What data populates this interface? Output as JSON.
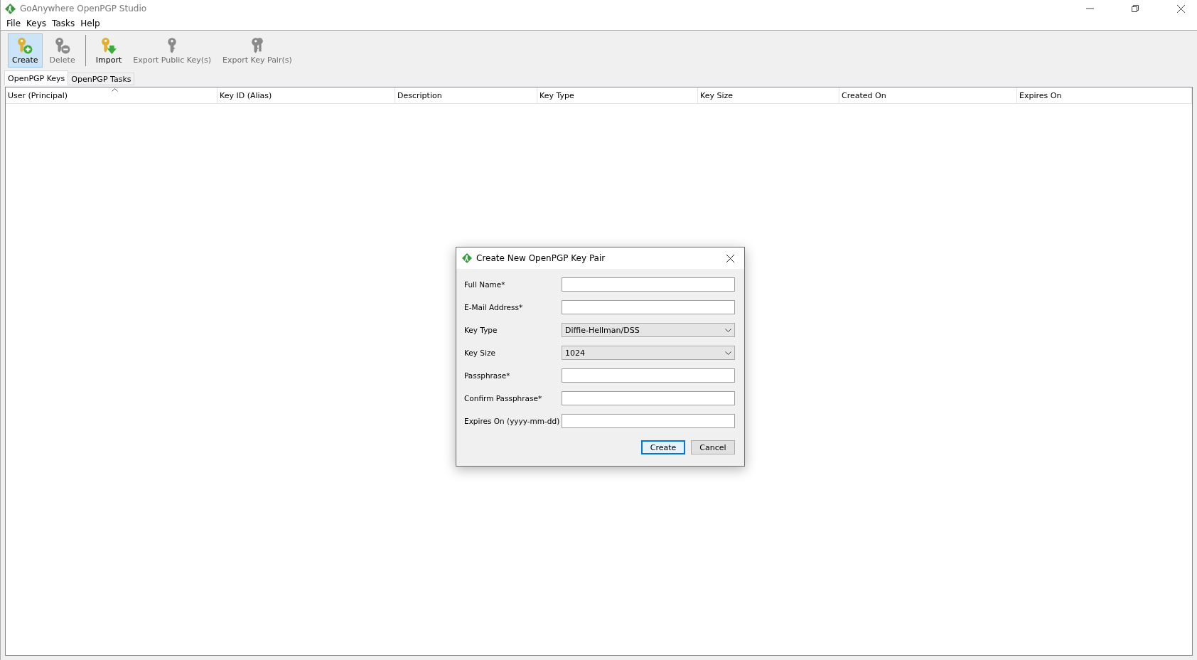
{
  "window": {
    "title": "GoAnywhere OpenPGP Studio"
  },
  "menu": [
    "File",
    "Keys",
    "Tasks",
    "Help"
  ],
  "toolbar": [
    {
      "label": "Create",
      "kind": "create",
      "selected": true,
      "disabled": false
    },
    {
      "label": "Delete",
      "kind": "delete",
      "selected": false,
      "disabled": true
    },
    {
      "label": "Import",
      "kind": "import",
      "selected": false,
      "disabled": false
    },
    {
      "label": "Export Public Key(s)",
      "kind": "export",
      "selected": false,
      "disabled": true
    },
    {
      "label": "Export Key Pair(s)",
      "kind": "export-pair",
      "selected": false,
      "disabled": true
    }
  ],
  "tabs": [
    {
      "label": "OpenPGP Keys",
      "selected": true
    },
    {
      "label": "OpenPGP Tasks",
      "selected": false
    }
  ],
  "table": {
    "columns": [
      {
        "label": "User (Principal)",
        "sorted": true
      },
      {
        "label": "Key ID (Alias)",
        "sorted": false
      },
      {
        "label": "Description",
        "sorted": false
      },
      {
        "label": "Key Type",
        "sorted": false
      },
      {
        "label": "Key Size",
        "sorted": false
      },
      {
        "label": "Created On",
        "sorted": false
      },
      {
        "label": "Expires On",
        "sorted": false
      }
    ]
  },
  "dialog": {
    "title": "Create New OpenPGP Key Pair",
    "fields": [
      {
        "label": "Full Name*",
        "kind": "text"
      },
      {
        "label": "E-Mail Address*",
        "kind": "text"
      },
      {
        "label": "Key Type",
        "kind": "select",
        "value": "Diffie-Hellman/DSS"
      },
      {
        "label": "Key Size",
        "kind": "select",
        "value": "1024"
      },
      {
        "label": "Passphrase*",
        "kind": "text"
      },
      {
        "label": "Confirm Passphrase*",
        "kind": "text"
      },
      {
        "label": "Expires On (yyyy-mm-dd)",
        "kind": "text"
      }
    ],
    "buttons": [
      {
        "label": "Create",
        "selected": true
      },
      {
        "label": "Cancel",
        "selected": false
      }
    ]
  }
}
